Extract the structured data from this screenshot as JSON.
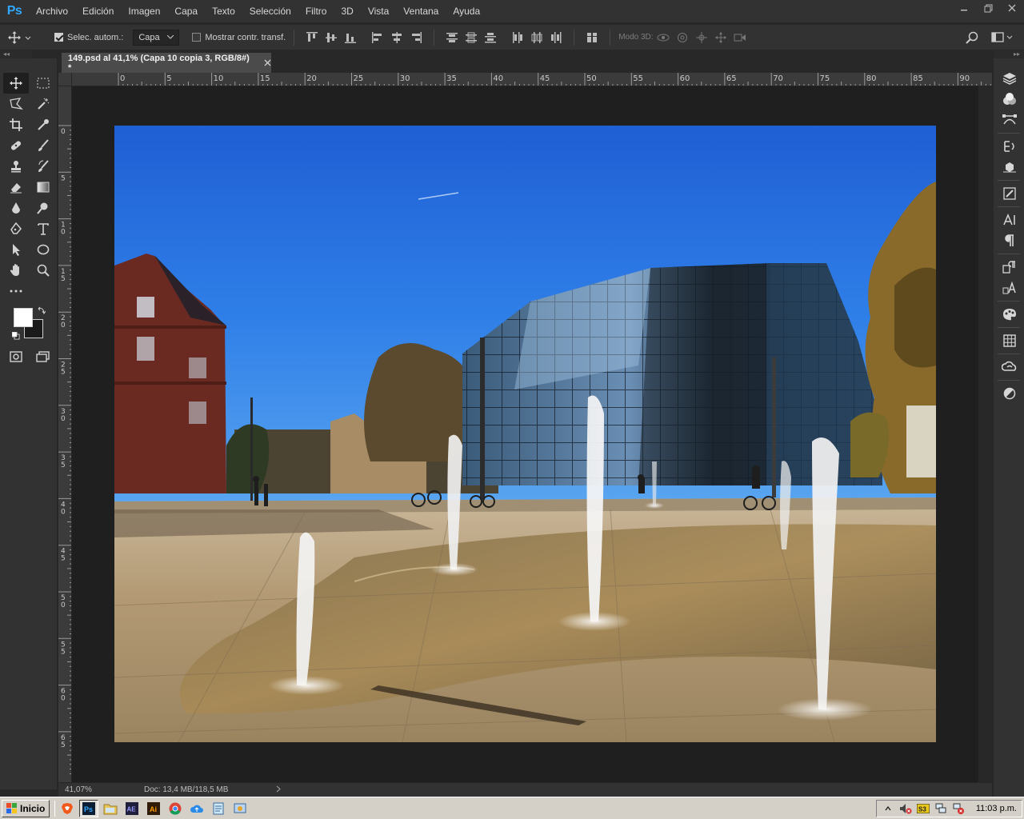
{
  "app": {
    "logo": "Ps",
    "menu": [
      "Archivo",
      "Edición",
      "Imagen",
      "Capa",
      "Texto",
      "Selección",
      "Filtro",
      "3D",
      "Vista",
      "Ventana",
      "Ayuda"
    ]
  },
  "options_bar": {
    "auto_select_label": "Selec. autom.:",
    "auto_select_checked": true,
    "auto_select_target": "Capa",
    "show_transform_label": "Mostrar contr. transf.",
    "show_transform_checked": false,
    "mode_3d_label": "Modo 3D:"
  },
  "document": {
    "tab_title": "149.psd al 41,1% (Capa 10 copia 3, RGB/8#) *",
    "zoom": "41,07%",
    "doc_size": "Doc: 13,4 MB/118,5 MB"
  },
  "rulers": {
    "horizontal": [
      "0",
      "5",
      "10",
      "15",
      "20",
      "25",
      "30",
      "35",
      "40",
      "45",
      "50",
      "55",
      "60",
      "65",
      "70",
      "75",
      "80",
      "85",
      "90"
    ],
    "vertical": [
      "0",
      "5",
      "10",
      "15",
      "20",
      "25",
      "30",
      "35",
      "40",
      "45",
      "50",
      "55",
      "60",
      "65"
    ]
  },
  "colors": {
    "foreground": "#ffffff",
    "background": "#1a1a1a",
    "accent": "#31a8ff"
  },
  "taskbar": {
    "start_label": "Inicio",
    "clock": "11:03 p.m.",
    "apps": [
      "brave",
      "photoshop",
      "file-explorer",
      "after-effects",
      "illustrator",
      "chrome",
      "cloud-app",
      "notepad",
      "control-panel"
    ]
  }
}
